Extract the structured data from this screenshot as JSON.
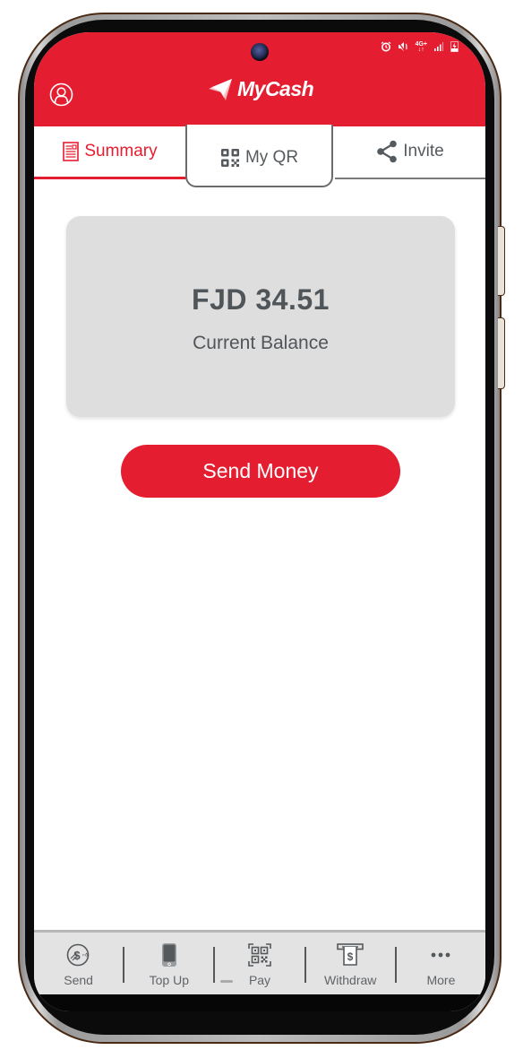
{
  "status_bar": {
    "icons": [
      "alarm-icon",
      "mute-icon",
      "network-4g-icon",
      "signal-icon",
      "battery-charging-icon"
    ],
    "network_label": "4G+"
  },
  "header": {
    "app_name": "MyCash",
    "brand_color": "#e41d30",
    "profile_icon": "user-circle-icon",
    "logo_icon": "paper-plane-icon"
  },
  "tabs": [
    {
      "label": "Summary",
      "icon": "document-icon",
      "active": true
    },
    {
      "label": "My QR",
      "icon": "qr-code-icon",
      "active": false
    },
    {
      "label": "Invite",
      "icon": "share-icon",
      "active": false
    }
  ],
  "balance": {
    "amount": "FJD 34.51",
    "label": "Current Balance"
  },
  "actions": {
    "send_money_label": "Send Money"
  },
  "bottom_nav": [
    {
      "label": "Send",
      "icon": "send-money-icon"
    },
    {
      "label": "Top Up",
      "icon": "phone-icon"
    },
    {
      "label": "Pay",
      "icon": "qr-code-icon"
    },
    {
      "label": "Withdraw",
      "icon": "atm-withdraw-icon"
    },
    {
      "label": "More",
      "icon": "more-dots-icon"
    }
  ]
}
